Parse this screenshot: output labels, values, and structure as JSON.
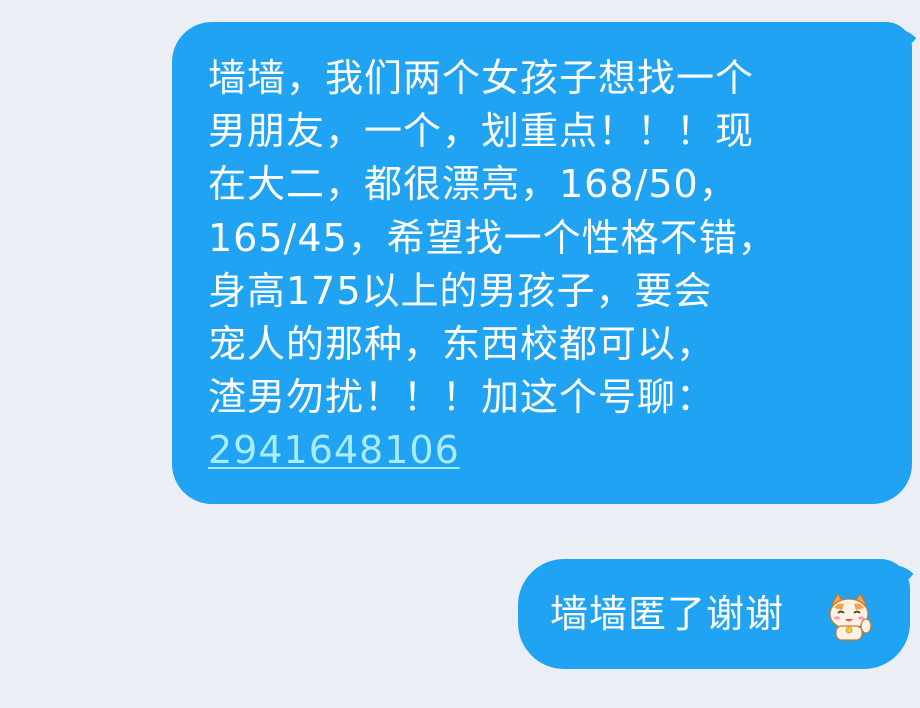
{
  "messages": [
    {
      "sender": "self",
      "lines": [
        "墙墙，我们两个女孩子想找一个",
        "男朋友，一个，划重点！！！现",
        "在大二，都很漂亮，168/50，",
        "165/45，希望找一个性格不错，",
        "身高175以上的男孩子，要会",
        "宠人的那种，东西校都可以，",
        "渣男勿扰！！！加这个号聊："
      ],
      "link": "2941648106"
    },
    {
      "sender": "self",
      "text": "墙墙匿了谢谢",
      "emoji": "cat-salute-emoji"
    }
  ],
  "colors": {
    "background": "#eceef6",
    "bubble": "#1fa3f2",
    "text": "#ffffff",
    "link": "#a9ebff"
  }
}
